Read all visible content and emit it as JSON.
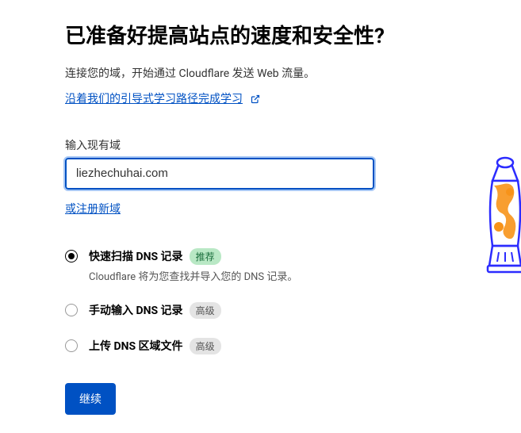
{
  "title": "已准备好提高站点的速度和安全性?",
  "subtitle": "连接您的域，开始通过 Cloudflare 发送 Web 流量。",
  "learning_link": "沿着我们的引导式学习路径完成学习",
  "input_label": "输入现有域",
  "domain_value": "liezhechuhai.com",
  "register_link": "或注册新域",
  "options": [
    {
      "title": "快速扫描 DNS 记录",
      "badge": "推荐",
      "badge_type": "recommended",
      "desc": "Cloudflare 将为您查找并导入您的 DNS 记录。",
      "selected": true
    },
    {
      "title": "手动输入 DNS 记录",
      "badge": "高级",
      "badge_type": "advanced",
      "selected": false
    },
    {
      "title": "上传 DNS 区域文件",
      "badge": "高级",
      "badge_type": "advanced",
      "selected": false
    }
  ],
  "continue_label": "继续"
}
